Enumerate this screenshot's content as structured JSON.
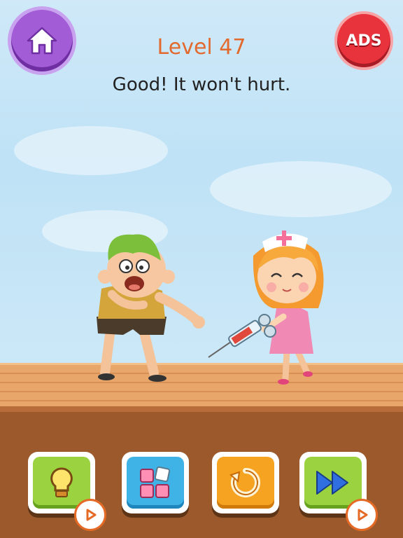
{
  "header": {
    "level_text": "Level 47",
    "hint_text": "Good! It won't hurt.",
    "ads_label": "ADS"
  },
  "icons": {
    "home": "home-icon",
    "ads": "ads-badge",
    "hint": "lightbulb-icon",
    "puzzle": "pieces-icon",
    "retry": "restart-icon",
    "skip": "fast-forward-icon",
    "video": "play-video-icon"
  },
  "colors": {
    "level": "#e36a2e",
    "home_button": "#a15cd6",
    "ads_button": "#e8323c",
    "hint_button": "#9ad33f",
    "pieces_button": "#3fb3e6",
    "retry_button": "#f7a322",
    "skip_button": "#9ad33f"
  },
  "scene": {
    "characters": [
      "boy",
      "nurse"
    ],
    "prop": "syringe"
  }
}
